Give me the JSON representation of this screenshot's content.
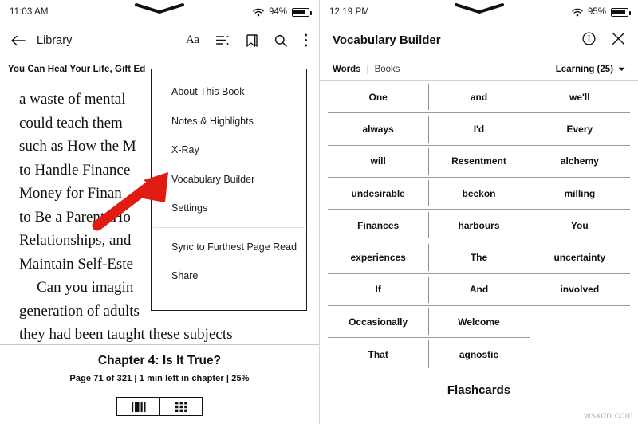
{
  "left": {
    "status": {
      "time": "11:03 AM",
      "battery_pct": "94%",
      "wifi_icon": "wifi-icon",
      "battery_icon": "battery-icon",
      "notch_icon": "notch-chevron-icon"
    },
    "toolbar": {
      "back_icon": "back-arrow-icon",
      "label": "Library",
      "icons": [
        {
          "name": "font-size-icon",
          "glyph": "Aa"
        },
        {
          "name": "table-of-contents-icon",
          "glyph": ""
        },
        {
          "name": "bookmark-icon",
          "glyph": ""
        },
        {
          "name": "search-icon",
          "glyph": ""
        },
        {
          "name": "more-options-icon",
          "glyph": ""
        }
      ]
    },
    "book": {
      "title": "You Can Heal Your Life, Gift Ed",
      "lines": [
        {
          "text": "a waste of mental",
          "indent": false
        },
        {
          "text": "could teach them",
          "indent": false
        },
        {
          "text": "such as How the M",
          "indent": false
        },
        {
          "text": "to Handle Finance",
          "indent": false
        },
        {
          "text": "Money for Finan",
          "indent": false
        },
        {
          "text": "to Be a Parent, Ho",
          "indent": false
        },
        {
          "text": "Relationships, and",
          "indent": false
        },
        {
          "text": "Maintain Self-Este",
          "indent": false
        },
        {
          "text": "Can you imagin",
          "indent": true
        },
        {
          "text": "generation of adults",
          "indent": false
        },
        {
          "text": "they had been taught these subjects",
          "indent": false
        }
      ]
    },
    "footer": {
      "chapter": "Chapter 4: Is It True?",
      "progress": "Page 71 of 321 | 1 min left in chapter | 25%",
      "view_buttons": [
        {
          "name": "page-view-button",
          "icon": "vertical-bars-icon"
        },
        {
          "name": "grid-view-button",
          "icon": "grid-squares-icon"
        }
      ]
    },
    "menu": {
      "items_top": [
        "About This Book",
        "Notes & Highlights",
        "X-Ray",
        "Vocabulary Builder",
        "Settings"
      ],
      "items_bottom": [
        "Sync to Furthest Page Read",
        "Share"
      ]
    },
    "annotation": {
      "arrow_icon": "red-arrow-pointer",
      "arrow_color": "#e01b12"
    }
  },
  "right": {
    "status": {
      "time": "12:19 PM",
      "battery_pct": "95%",
      "wifi_icon": "wifi-icon",
      "battery_icon": "battery-icon",
      "notch_icon": "notch-chevron-icon"
    },
    "header": {
      "title": "Vocabulary Builder",
      "info_icon": "info-circle-icon",
      "close_icon": "close-x-icon"
    },
    "subbar": {
      "tab_words": "Words",
      "tab_divider": "|",
      "tab_books": "Books",
      "filter_label": "Learning (25)",
      "filter_icon": "chevron-down-icon"
    },
    "words_rows": [
      [
        "One",
        "and",
        "we'll"
      ],
      [
        "always",
        "I'd",
        "Every"
      ],
      [
        "will",
        "Resentment",
        "alchemy"
      ],
      [
        "undesirable",
        "beckon",
        "milling"
      ],
      [
        "Finances",
        "harbours",
        "You"
      ],
      [
        "experiences",
        "The",
        "uncertainty"
      ],
      [
        "If",
        "And",
        "involved"
      ],
      [
        "Occasionally",
        "Welcome",
        ""
      ],
      [
        "That",
        "agnostic",
        ""
      ]
    ],
    "flashcards_label": "Flashcards"
  },
  "watermark": "wsxdn.com"
}
